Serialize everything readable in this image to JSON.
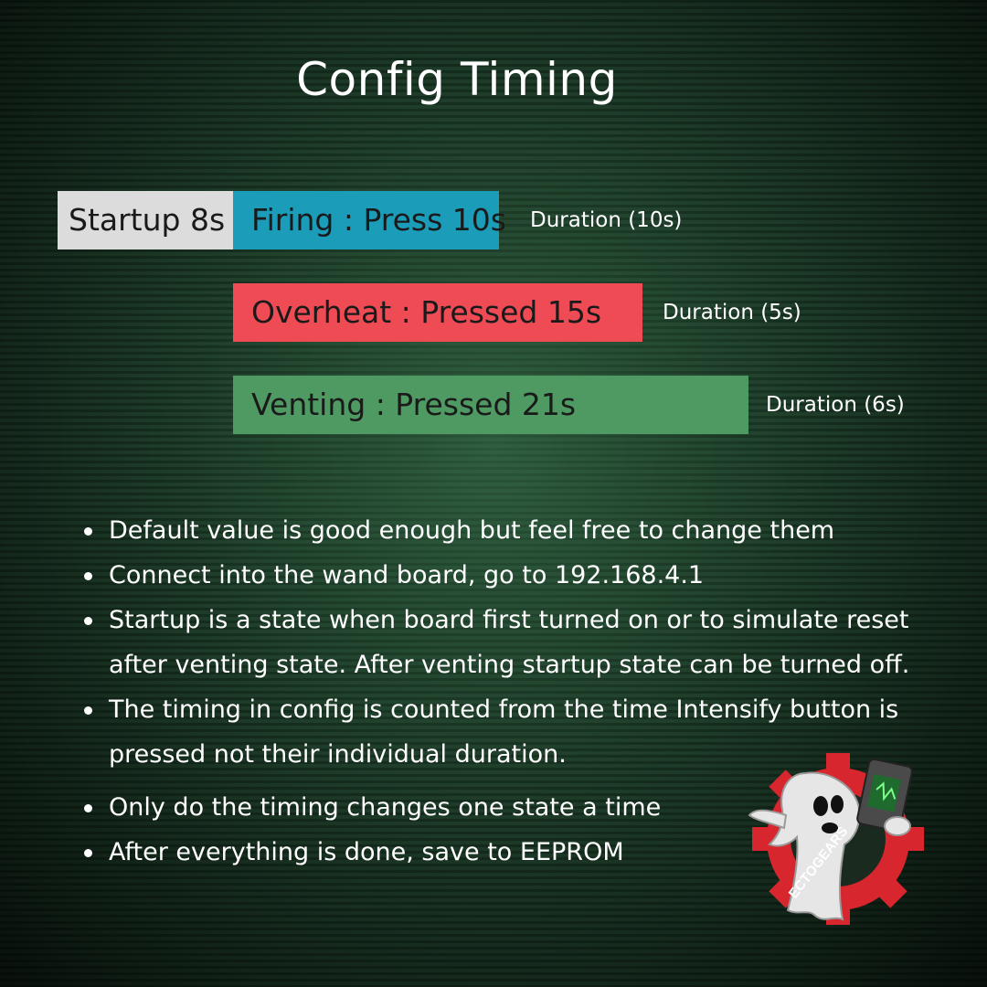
{
  "title": "Config Timing",
  "timeline": [
    {
      "label": "Startup 8s",
      "color": "#dcdcdc"
    },
    {
      "label": "Firing : Press 10s",
      "color": "#1b9dba",
      "duration": "Duration (10s)"
    },
    {
      "label": "Overheat : Pressed 15s",
      "color": "#ee4b55",
      "duration": "Duration (5s)"
    },
    {
      "label": "Venting : Pressed 21s",
      "color": "#4e9a62",
      "duration": "Duration (6s)"
    }
  ],
  "notes": [
    "Default value is good enough but feel free to change them",
    "Connect into the wand board, go to 192.168.4.1",
    "Startup is a state when board first turned on or to simulate reset after venting state. After venting startup state can be turned off.",
    "The timing in config is counted from the time Intensify button is pressed not their individual duration.",
    "Only do the timing changes one state a time",
    "After everything is done, save to EEPROM"
  ],
  "logo": {
    "text": "ECTOGEARS",
    "icon": "ghost-gear-logo-icon"
  }
}
